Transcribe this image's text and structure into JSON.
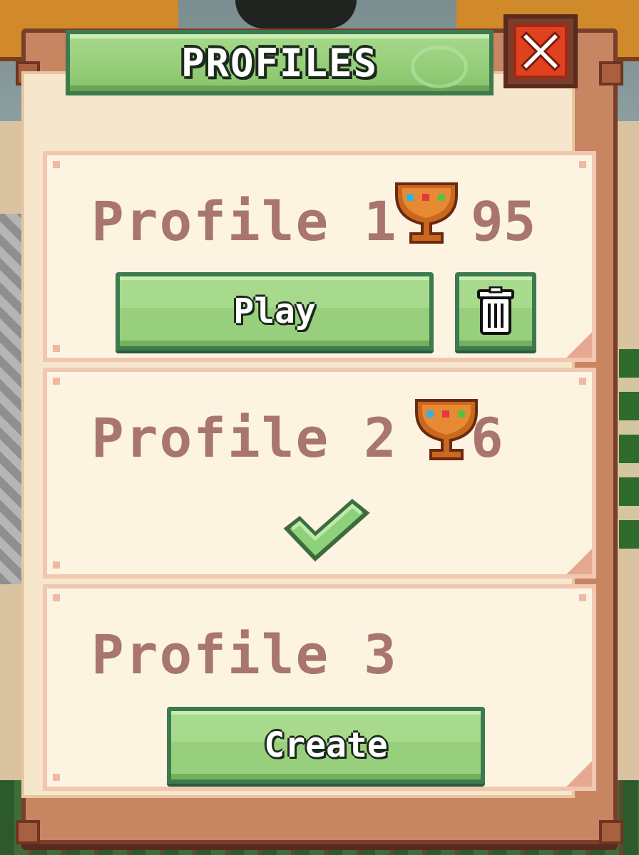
{
  "dialog": {
    "title": "PROFILES",
    "close_icon": "close-x-icon"
  },
  "profiles": [
    {
      "name": "Profile 1",
      "trophies": "95",
      "action_label": "Play",
      "delete_icon": "trash-icon",
      "trophy_icon": "trophy-icon"
    },
    {
      "name": "Profile 2",
      "trophies": "6",
      "state_icon": "checkmark-icon",
      "trophy_icon": "trophy-icon"
    },
    {
      "name": "Profile 3",
      "action_label": "Create"
    }
  ],
  "colors": {
    "panel_bg": "#fdf3e1",
    "frame": "#c88561",
    "button_green": "#98cf7c",
    "text_profile": "#a8766e",
    "close_red": "#e0421f"
  }
}
